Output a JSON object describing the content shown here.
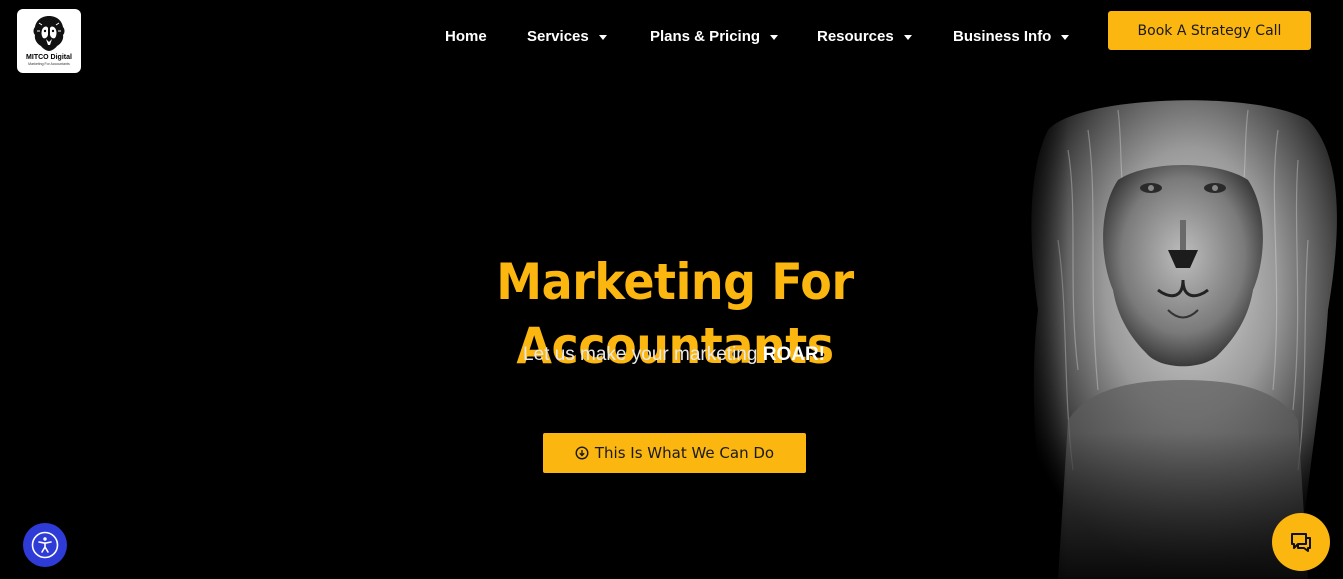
{
  "brand": {
    "name": "MITCO Digital",
    "tagline": "Marketing For Accountants"
  },
  "nav": {
    "items": [
      {
        "label": "Home",
        "has_dropdown": false
      },
      {
        "label": "Services",
        "has_dropdown": true
      },
      {
        "label": "Plans & Pricing",
        "has_dropdown": true
      },
      {
        "label": "Resources",
        "has_dropdown": true
      },
      {
        "label": "Business Info",
        "has_dropdown": true
      }
    ],
    "cta_label": "Book A Strategy Call"
  },
  "hero": {
    "title": "Marketing For Accountants",
    "subtitle_prefix": "Let us make your marketing ",
    "subtitle_emphasis": "ROAR!",
    "cta_label": "This Is What We Can Do"
  },
  "widgets": {
    "accessibility_icon": "accessibility-icon",
    "chat_icon": "chat-icon"
  },
  "colors": {
    "background": "#000000",
    "accent": "#fbb60f",
    "nav_text": "#ffffff",
    "accessibility_bg": "#2e3bd6"
  }
}
